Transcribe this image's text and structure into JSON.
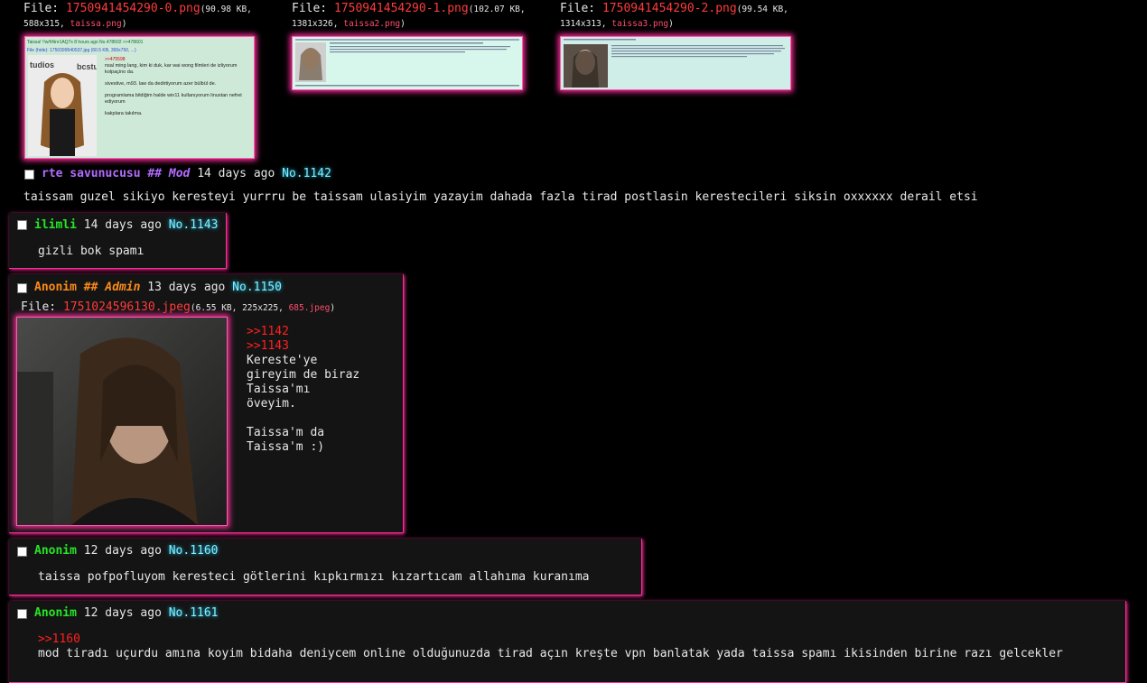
{
  "op": {
    "files": [
      {
        "label": "File:",
        "filename": "1750941454290-0.png",
        "size": "90.98 KB,",
        "dimensions": "588x315,",
        "original": "taissa.png",
        "thumb_lines": [
          "Taissa! !!w/hNnr1AQ7x  8 hours ago  No.478602  >>478601",
          "File (hide): 1750399540537.jpg (60.5 KB, 300x750, ...)",
          ">>475598",
          "nsal ming lang, kim ki duk, kar wai wong filmleri de izliyorum",
          "kolpaçino da.",
          "sivestive, m93. law da dedirtiyorum azer bülbül de.",
          "programlama bildiğim halde win11 kullanıyorum linuxtan nefret",
          "ediyorum",
          "kakplara takılma."
        ]
      },
      {
        "label": "File:",
        "filename": "1750941454290-1.png",
        "size": "102.07 KB,",
        "dimensions": "1381x326,",
        "original": "taissa2.png"
      },
      {
        "label": "File:",
        "filename": "1750941454290-2.png",
        "size": "99.54 KB,",
        "dimensions": "1314x313,",
        "original": "taissa3.png"
      }
    ],
    "name": "rte savunucusu",
    "capcode": "## Mod",
    "date": "14 days ago",
    "post_no": "No.1142",
    "comment": "taissam guzel sikiyo keresteyi yurrru be taissam ulasiyim yazayim dahada fazla tirad postlasin kerestecileri siksin oxxxxxx derail etsi"
  },
  "replies": [
    {
      "name": "ilimli",
      "date": "14 days ago",
      "post_no": "No.1143",
      "comment": "gizli bok spamı"
    },
    {
      "name": "Anonim",
      "capcode": "## Admin",
      "date": "13 days ago",
      "post_no": "No.1150",
      "file": {
        "label": "File:",
        "filename": "1751024596130.jpeg",
        "size": "6.55 KB, 225x225,",
        "original": "685.jpeg"
      },
      "quotes": [
        ">>1142",
        ">>1143"
      ],
      "comment_lines": [
        "Kereste'ye",
        "gireyim de biraz",
        "Taissa'mı",
        "öveyim.",
        "",
        "Taissa'm da",
        "Taissa'm :)"
      ]
    },
    {
      "name": "Anonim",
      "date": "12 days ago",
      "post_no": "No.1160",
      "comment": "taissa pofpofluyom keresteci götlerini kıpkırmızı kızartıcam allahıma kuranıma"
    },
    {
      "name": "Anonim",
      "date": "12 days ago",
      "post_no": "No.1161",
      "quote": ">>1160",
      "comment": "mod tiradı uçurdu amına koyim bidaha deniycem online olduğunuzda tirad açın kreşte vpn banlatak yada taissa spamı ikisinden birine razı gelcekler"
    }
  ],
  "colors": {
    "background": "#000000",
    "post_bg": "#141414",
    "accent_glow": "#ff2d9a",
    "name_green": "#26e626",
    "mod_purple": "#b36bff",
    "admin_orange": "#ff8a1a",
    "quote_red": "#ff2020",
    "postno_cyan": "#7ff0ff"
  }
}
